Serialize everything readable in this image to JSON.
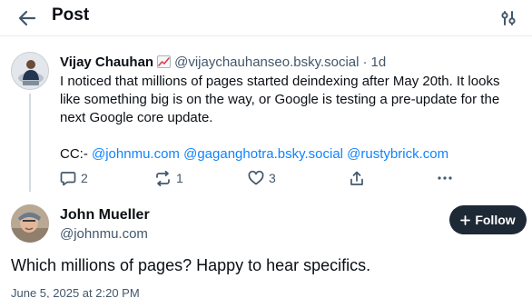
{
  "header": {
    "title": "Post",
    "back_icon": "arrow-left-icon",
    "filter_icon": "sliders-icon"
  },
  "parent_post": {
    "author_name": "Vijay Chauhan",
    "author_emoji": "chart-increasing-emoji",
    "author_handle": "@vijaychauhanseo.bsky.social",
    "age": "1d",
    "text": "I noticed that millions of pages started deindexing after May 20th. It looks like something big is on the way, or Google is testing a pre-update for the next Google core update.",
    "cc_prefix": "CC:-",
    "mentions": [
      "@johnmu.com",
      "@gaganghotra.bsky.social",
      "@rustybrick.com"
    ],
    "actions": {
      "replies": "2",
      "reposts": "1",
      "likes": "3"
    }
  },
  "reply_post": {
    "author_name": "John Mueller",
    "author_handle": "@johnmu.com",
    "follow_label": "Follow",
    "text": "Which millions of pages? Happy to hear specifics.",
    "timestamp": "June 5, 2025 at 2:20 PM"
  },
  "colors": {
    "text": "#0b0f14",
    "secondary": "#42576c",
    "link": "#1083fe",
    "follow_button": "#1e2936",
    "divider": "#e6ebef"
  }
}
